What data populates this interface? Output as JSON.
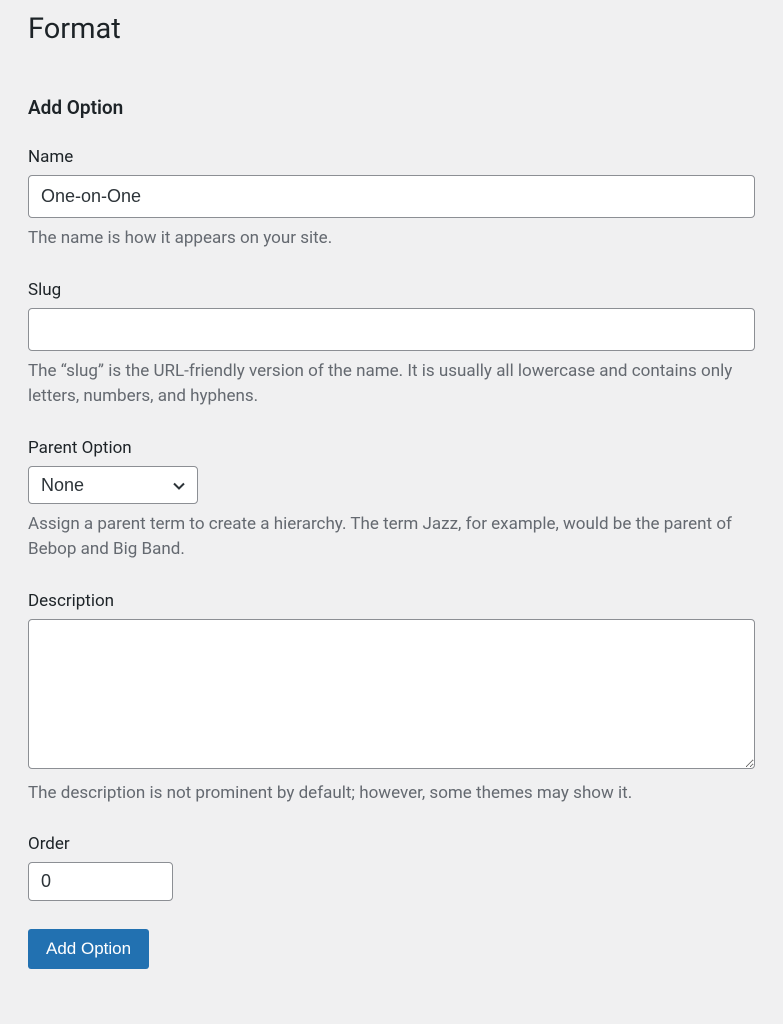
{
  "page": {
    "title": "Format"
  },
  "form": {
    "section_title": "Add Option",
    "name": {
      "label": "Name",
      "value": "One-on-One",
      "help": "The name is how it appears on your site."
    },
    "slug": {
      "label": "Slug",
      "value": "",
      "help": "The “slug” is the URL-friendly version of the name. It is usually all lowercase and contains only letters, numbers, and hyphens."
    },
    "parent": {
      "label": "Parent Option",
      "selected": "None",
      "help": "Assign a parent term to create a hierarchy. The term Jazz, for example, would be the parent of Bebop and Big Band."
    },
    "description": {
      "label": "Description",
      "value": "",
      "help": "The description is not prominent by default; however, some themes may show it."
    },
    "order": {
      "label": "Order",
      "value": "0"
    },
    "submit_label": "Add Option"
  }
}
